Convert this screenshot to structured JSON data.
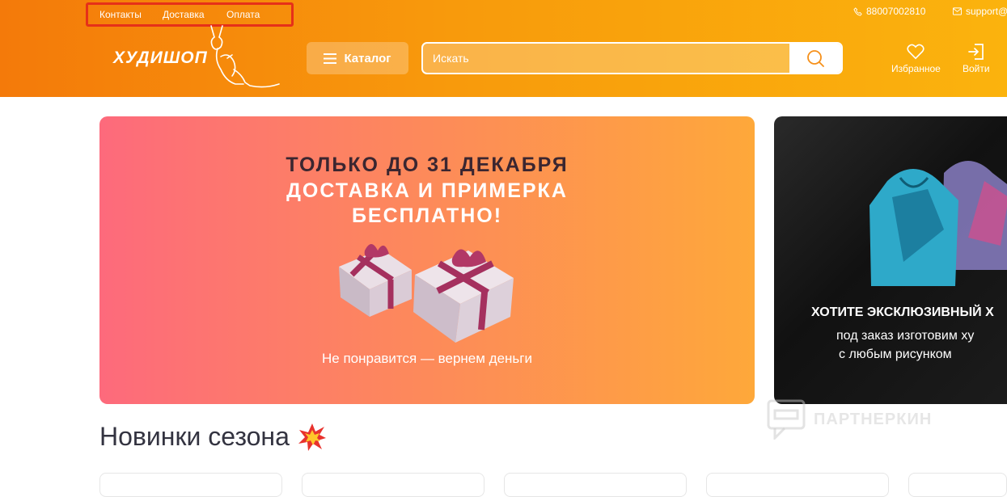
{
  "header": {
    "top_links": [
      "Контакты",
      "Доставка",
      "Оплата"
    ],
    "phone": "88007002810",
    "email": "support@",
    "logo": "ХУДИШОП",
    "catalog_label": "Каталог",
    "search_placeholder": "Искать",
    "favorites_label": "Избранное",
    "login_label": "Войти"
  },
  "promo_banner": {
    "line1": "ТОЛЬКО ДО 31 ДЕКАБРЯ",
    "line2": "ДОСТАВКА И ПРИМЕРКА",
    "line3": "БЕСПЛАТНО!",
    "subtitle": "Не понравится — вернем деньги"
  },
  "custom_banner": {
    "title": "ХОТИТЕ ЭКСКЛЮЗИВНЫЙ Х",
    "line2": "под заказ изготовим ху",
    "line3": "с любым рисунком"
  },
  "watermark": "ПАРТНЕРКИН",
  "section": {
    "title": "Новинки сезона"
  },
  "colors": {
    "header_start": "#f47a0a",
    "header_end": "#fbb30d",
    "highlight_box": "#e63019",
    "heading_text": "#333340"
  }
}
